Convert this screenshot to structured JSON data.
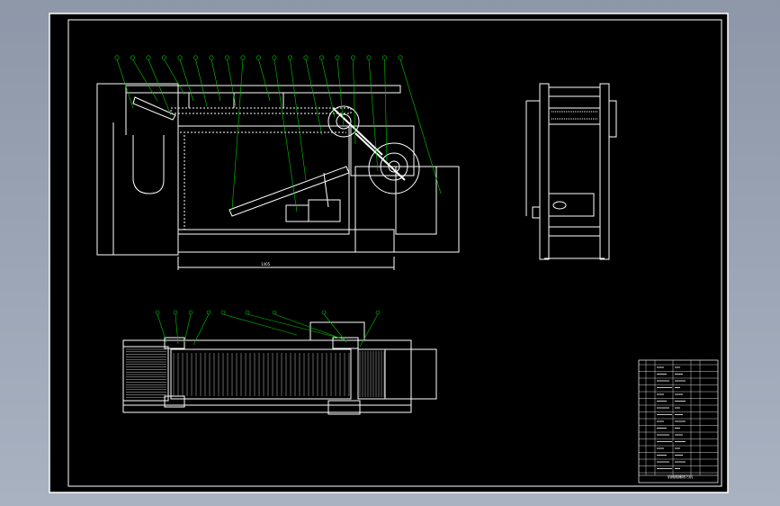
{
  "drawing": {
    "background_color": "#000000",
    "frame_color": "#ffffff",
    "leader_color": "#00c800",
    "part_color": "#ffffff"
  },
  "front_view": {
    "balloon_count": 19,
    "dimension_label": "1405"
  },
  "top_view": {
    "balloon_count": 9
  },
  "title_block": {
    "drawing_name": "机械格栅除污机"
  }
}
